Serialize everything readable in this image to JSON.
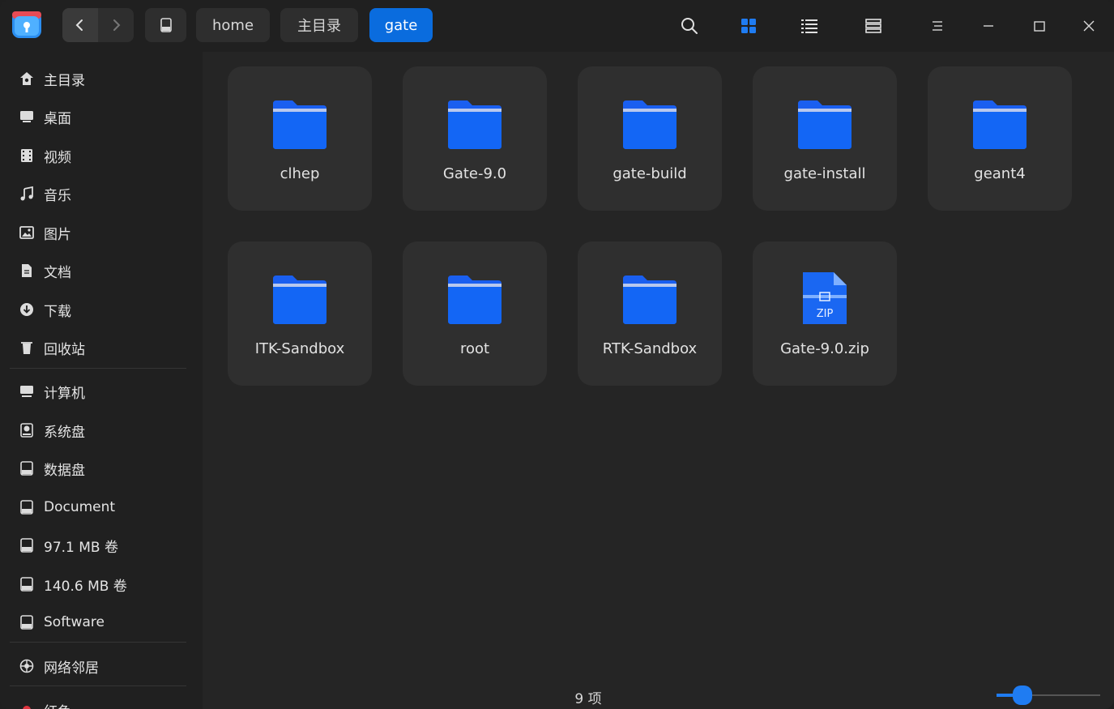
{
  "breadcrumbs": [
    "home",
    "主目录",
    "gate"
  ],
  "sidebar": {
    "items": [
      {
        "label": "主目录",
        "icon": "home-icon"
      },
      {
        "label": "桌面",
        "icon": "desktop-icon"
      },
      {
        "label": "视频",
        "icon": "video-icon"
      },
      {
        "label": "音乐",
        "icon": "music-icon"
      },
      {
        "label": "图片",
        "icon": "picture-icon"
      },
      {
        "label": "文档",
        "icon": "document-icon"
      },
      {
        "label": "下载",
        "icon": "download-icon"
      },
      {
        "label": "回收站",
        "icon": "trash-icon"
      },
      {
        "label": "计算机",
        "icon": "computer-icon"
      },
      {
        "label": "系统盘",
        "icon": "system-disk-icon"
      },
      {
        "label": "数据盘",
        "icon": "disk-icon"
      },
      {
        "label": "Document",
        "icon": "disk-icon"
      },
      {
        "label": "97.1 MB 卷",
        "icon": "disk-icon"
      },
      {
        "label": "140.6 MB 卷",
        "icon": "disk-icon"
      },
      {
        "label": "Software",
        "icon": "disk-icon"
      },
      {
        "label": "网络邻居",
        "icon": "network-icon"
      },
      {
        "label": "红色",
        "icon": "red-tag-icon"
      }
    ]
  },
  "files": [
    {
      "name": "clhep",
      "type": "folder"
    },
    {
      "name": "Gate-9.0",
      "type": "folder"
    },
    {
      "name": "gate-build",
      "type": "folder"
    },
    {
      "name": "gate-install",
      "type": "folder"
    },
    {
      "name": "geant4",
      "type": "folder"
    },
    {
      "name": "ITK-Sandbox",
      "type": "folder"
    },
    {
      "name": "root",
      "type": "folder"
    },
    {
      "name": "RTK-Sandbox",
      "type": "folder"
    },
    {
      "name": "Gate-9.0.zip",
      "type": "zip",
      "badge": "ZIP"
    }
  ],
  "status": {
    "item_count": "9 项"
  },
  "zoom": {
    "level": 0.25
  },
  "colors": {
    "accent": "#0a6cde",
    "folder": "#1a5ff0"
  }
}
